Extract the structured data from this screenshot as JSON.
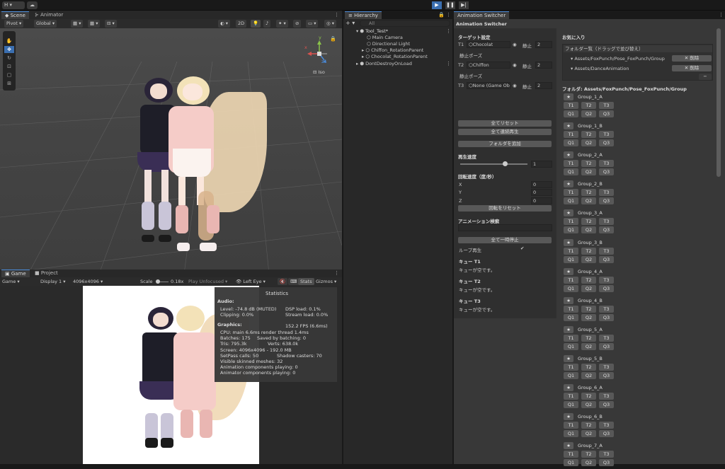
{
  "topbar": {
    "account": "H",
    "play_icon": "play-icon",
    "pause_icon": "pause-icon",
    "step_icon": "step-icon"
  },
  "tabs": {
    "scene": "Scene",
    "animator": "Animator",
    "hierarchy": "Hierarchy",
    "anim_switcher": "Animation Switcher",
    "game": "Game",
    "project": "Project"
  },
  "scene_toolbar": {
    "pivot": "Pivot",
    "global": "Global",
    "mode2d": "2D",
    "iso": "Iso",
    "axis_y": "y",
    "axis_x": "x",
    "axis_z": "z"
  },
  "game_toolbar": {
    "mode": "Game",
    "display": "Display 1",
    "resolution": "4096x4096",
    "scale_label": "Scale",
    "scale_value": "0.18x",
    "play_mode": "Play Unfocused",
    "eye": "Left Eye",
    "stats": "Stats",
    "gizmos": "Gizmos"
  },
  "stats": {
    "title": "Statistics",
    "audio": "Audio:",
    "level": "Level: -74.8 dB (MUTED)",
    "clipping": "Clipping: 0.0%",
    "dsp": "DSP load: 0.1%",
    "stream": "Stream load: 0.0%",
    "graphics": "Graphics:",
    "fps": "152.2 FPS (6.6ms)",
    "cpu": "CPU: main 6.6ms  render thread 1.4ms",
    "batches": "Batches: 175",
    "saved": "Saved by batching: 0",
    "tris": "Tris: 795.3k",
    "verts": "Verts: 638.0k",
    "screen": "Screen: 4096x4096 - 192.0 MB",
    "setpass": "SetPass calls: 50",
    "shadow": "Shadow casters: 70",
    "skinned": "Visible skinned meshes: 32",
    "animcomp": "Animation components playing: 0",
    "animatorcomp": "Animator components playing: 0"
  },
  "hierarchy": {
    "search": "All",
    "root": "Tool_Test*",
    "items": [
      "Main Camera",
      "Directional Light",
      "Chiffon_RotationParent",
      "Chocolat_RotationParent"
    ],
    "dontdestroy": "DontDestroyOnLoad"
  },
  "switcher": {
    "title": "Animation Switcher",
    "target_header": "ターゲット設定",
    "targets": [
      {
        "label": "T1",
        "obj": "Chocolat",
        "state": "静止",
        "num": "2",
        "pose": "静止ポーズ"
      },
      {
        "label": "T2",
        "obj": "Chiffon",
        "state": "静止",
        "num": "2",
        "pose": "静止ポーズ"
      },
      {
        "label": "T3",
        "obj": "None (Game Obje",
        "state": "静止",
        "num": "2"
      }
    ],
    "reset_all": "全てリセット",
    "play_all": "全て連続再生",
    "add_folder": "フォルダを追加",
    "speed_header": "再生速度",
    "speed_value": "1",
    "rot_header": "回転速度（度/秒）",
    "rx": "X",
    "ry": "Y",
    "rz": "Z",
    "rxv": "0",
    "ryv": "0",
    "rzv": "0",
    "rot_reset": "回転をリセット",
    "search_header": "アニメーション検索",
    "pause_all": "全て一時停止",
    "loop": "ループ再生",
    "loop_check": "✔",
    "queues": [
      {
        "h": "キュー T1",
        "t": "キューが空です。"
      },
      {
        "h": "キュー T2",
        "t": "キューが空です。"
      },
      {
        "h": "キュー T3",
        "t": "キューが空です。"
      }
    ],
    "fav_header": "お気に入り",
    "folder_list": "フォルダー覧（ドラッグで並び替え）",
    "favs": [
      {
        "path": "Assets/FoxPunch/Pose_FoxPunch/Group",
        "del": "✕ 削除"
      },
      {
        "path": "Assets/DanceAnimation",
        "del": "✕ 削除"
      }
    ],
    "minus": "−",
    "folder_path": "フォルダ: Assets/FoxPunch/Pose_FoxPunch/Group",
    "groups": [
      "Group_1_A",
      "Group_1_B",
      "Group_2_A",
      "Group_2_B",
      "Group_3_A",
      "Group_3_B",
      "Group_4_A",
      "Group_4_B",
      "Group_5_A",
      "Group_5_B",
      "Group_6_A",
      "Group_6_B",
      "Group_7_A"
    ],
    "star": "★",
    "t_buttons": [
      "T1",
      "T2",
      "T3"
    ],
    "q_buttons": [
      "Q1",
      "Q2",
      "Q3"
    ]
  }
}
